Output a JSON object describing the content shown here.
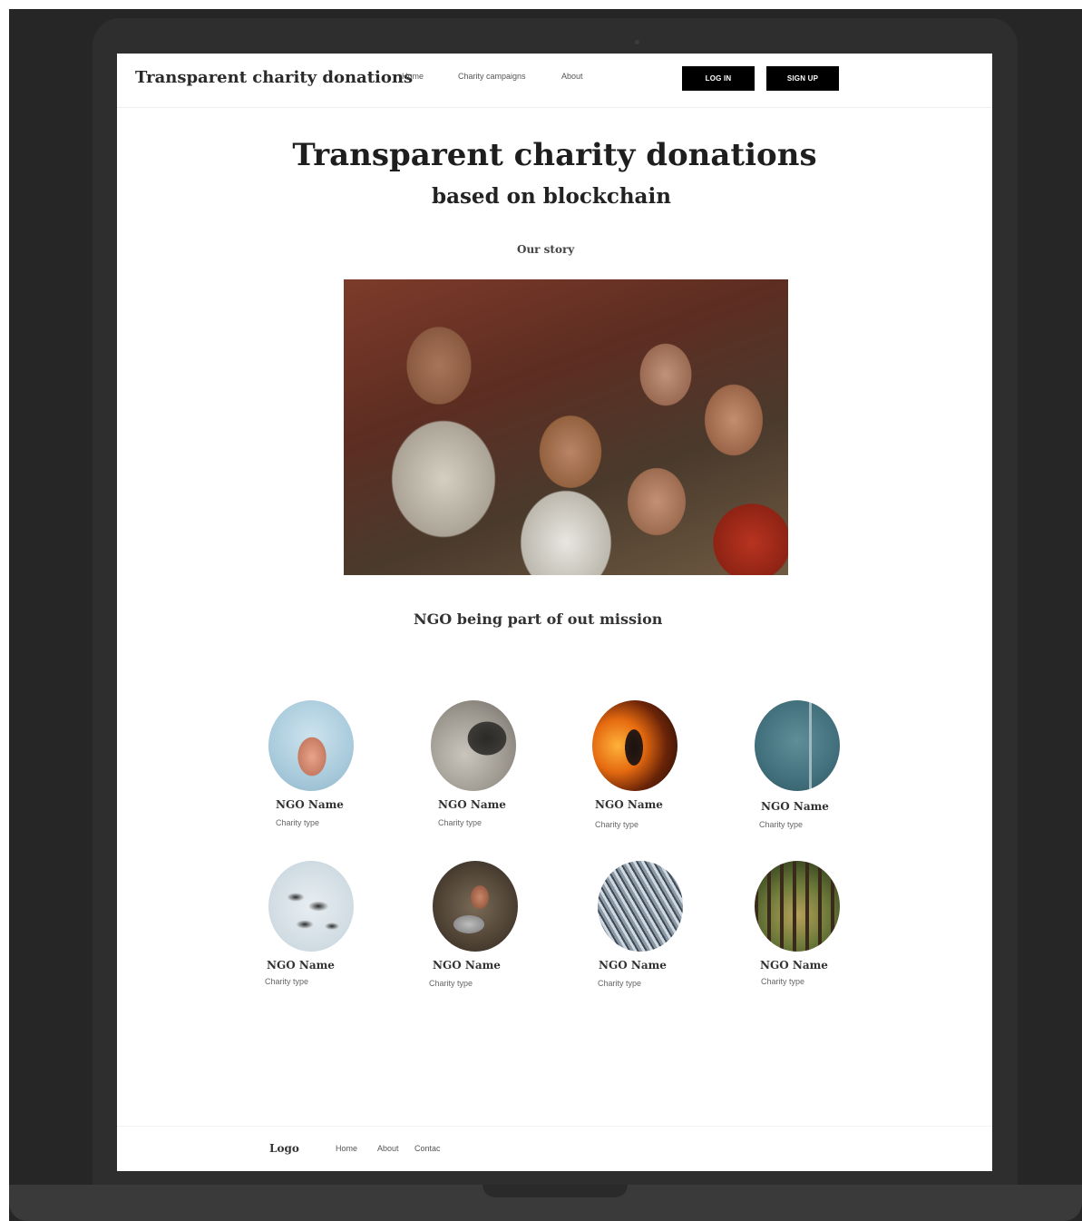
{
  "nav": {
    "brand": "Transparent charity donations",
    "links": [
      "Home",
      "Charity campaigns",
      "About"
    ],
    "login_label": "LOG IN",
    "signup_label": "SIGN UP"
  },
  "hero": {
    "title": "Transparent charity donations",
    "subtitle": "based on blockchain",
    "story_link": "Our story"
  },
  "ngo_section": {
    "title": "NGO being part of out mission",
    "items": [
      {
        "name": "NGO Name",
        "type": "Charity type"
      },
      {
        "name": "NGO Name",
        "type": "Charity type"
      },
      {
        "name": "NGO Name",
        "type": "Charity type"
      },
      {
        "name": "NGO Name",
        "type": "Charity type"
      },
      {
        "name": "NGO Name",
        "type": "Charity type"
      },
      {
        "name": "NGO Name",
        "type": "Charity type"
      },
      {
        "name": "NGO Name",
        "type": "Charity type"
      },
      {
        "name": "NGO Name",
        "type": "Charity type"
      }
    ]
  },
  "footer": {
    "logo": "Logo",
    "links": [
      "Home",
      "About",
      "Contac"
    ]
  }
}
